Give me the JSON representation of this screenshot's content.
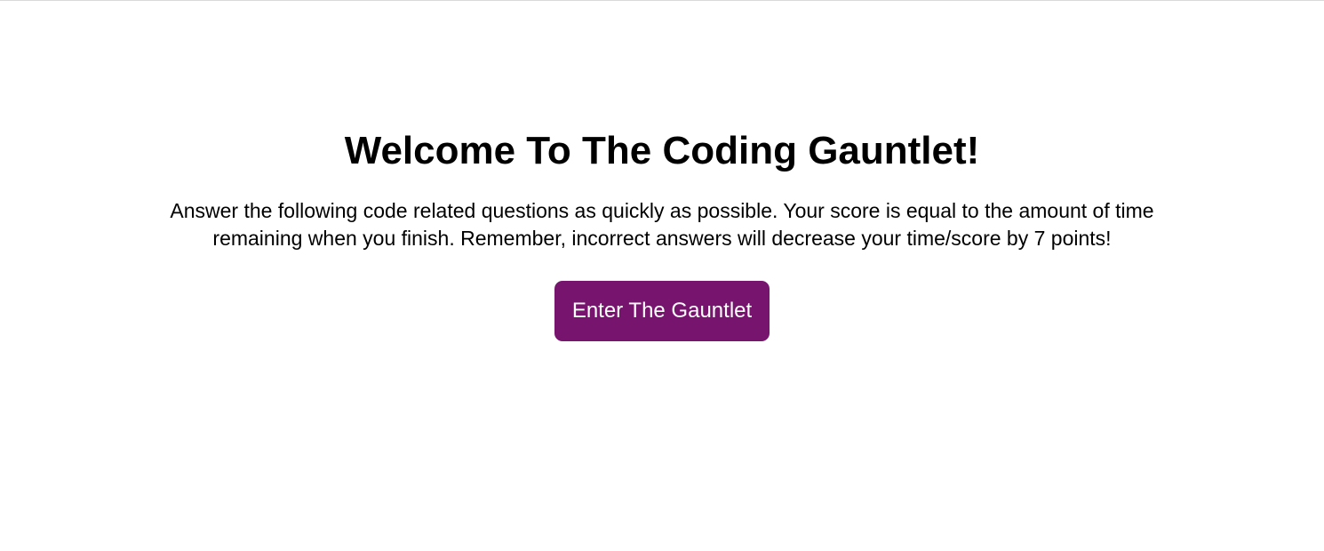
{
  "welcome": {
    "title": "Welcome To The Coding Gauntlet!",
    "instructions": "Answer the following code related questions as quickly as possible. Your score is equal to the amount of time remaining when you finish. Remember, incorrect answers will decrease your time/score by 7 points!",
    "start_label": "Enter The Gauntlet"
  },
  "colors": {
    "accent": "#77146e",
    "text": "#000000",
    "background": "#ffffff"
  }
}
